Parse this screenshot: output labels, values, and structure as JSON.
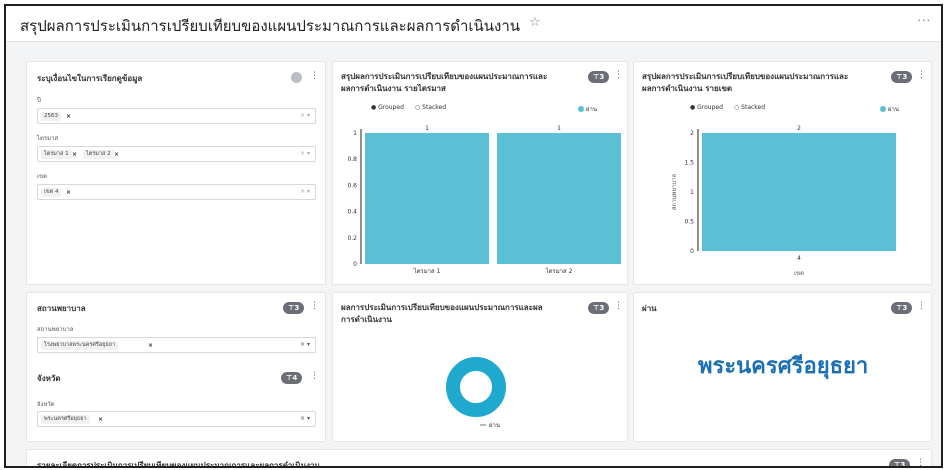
{
  "dashboard": {
    "title": "สรุปผลการประเมินการเปรียบเทียบของแผนประมาณการและผลการดำเนินงาน",
    "star_icon": "star-icon",
    "more_icon": "more-horizontal-icon"
  },
  "filters": {
    "title": "ระบุเงื่อนไขในการเรียกดูข้อมูล",
    "year_label": "ปี",
    "year_tags": [
      "2563"
    ],
    "quarter_label": "ไตรมาส",
    "quarter_tags": [
      "ไตรมาส 1",
      "ไตรมาส 2"
    ],
    "zone_label": "เขต",
    "zone_tags": [
      "เขต 4"
    ]
  },
  "hospital_filter": {
    "title": "สถานพยาบาล",
    "badge": "3",
    "label": "สถานพยาบาล",
    "tags": [
      "โรงพยาบาลพระนครศรีอยุธยา"
    ]
  },
  "province_filter": {
    "title": "จังหวัด",
    "badge": "4",
    "label": "จังหวัด",
    "tags": [
      "พระนครศรีอยุธยา"
    ]
  },
  "chart_quarter": {
    "title_line1": "สรุปผลการประเมินการเปรียบเทียบของแผนประมาณการและ",
    "title_line2": "ผลการดำเนินงาน รายไตรมาส",
    "badge": "3",
    "radio_grouped": "Grouped",
    "radio_stacked": "Stacked",
    "legend": "ผ่าน"
  },
  "chart_zone": {
    "title_line1": "สรุปผลการประเมินการเปรียบเทียบของแผนประมาณการและ",
    "title_line2": "ผลการดำเนินงาน รายเขต",
    "badge": "3",
    "radio_grouped": "Grouped",
    "radio_stacked": "Stacked",
    "legend": "ผ่าน"
  },
  "chart_donut": {
    "title_line1": "ผลการประเมินการเปรียบเทียบของแผนประมาณการและผล",
    "title_line2": "การดำเนินงาน",
    "badge": "3"
  },
  "bignumber": {
    "title": "ผ่าน",
    "badge": "3",
    "value": "พระนครศรีอยุธยา"
  },
  "detail": {
    "title": "รายละเอียดการประเมินการเปรียบเทียบของแผนประมาณการและผลการดำเนินงาน",
    "badge": "3"
  },
  "colors": {
    "bar": "#5bc0d6",
    "donut": "#20a9cf",
    "bignumber": "#1a6fb5"
  },
  "chart_data": [
    {
      "type": "bar",
      "categories": [
        "ไตรมาส 1",
        "ไตรมาส 2"
      ],
      "series": [
        {
          "name": "ผ่าน",
          "values": [
            1,
            1
          ]
        }
      ],
      "yticks": [
        "0",
        "0.2",
        "0.4",
        "0.6",
        "0.8",
        "1"
      ],
      "ylim": [
        0,
        1
      ],
      "data_labels": [
        "1",
        "1"
      ],
      "xlabel": "",
      "ylabel": ""
    },
    {
      "type": "bar",
      "categories": [
        "4"
      ],
      "series": [
        {
          "name": "ผ่าน",
          "values": [
            2
          ]
        }
      ],
      "yticks": [
        "0",
        "0.5",
        "1",
        "1.5",
        "2"
      ],
      "ylim": [
        0,
        2
      ],
      "data_labels": [
        "2"
      ],
      "xlabel": "เขต",
      "ylabel": "สถานพยาบาล"
    },
    {
      "type": "pie",
      "donut": true,
      "categories": [
        "ผ่าน"
      ],
      "values": [
        1
      ],
      "legend": "ผ่าน"
    }
  ]
}
